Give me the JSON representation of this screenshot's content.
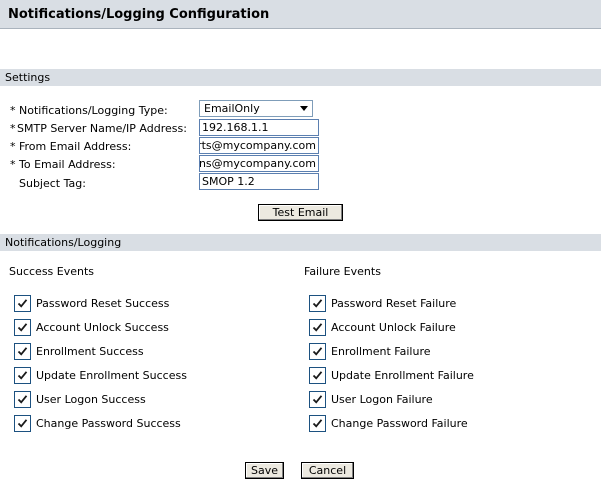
{
  "title": "Notifications/Logging Configuration",
  "settings": {
    "header": "Settings",
    "required_mark": "*",
    "fields": [
      {
        "label": "Notifications/Logging Type:",
        "required": true
      },
      {
        "label": "SMTP Server Name/IP Address:",
        "required": true,
        "value": "192.168.1.1"
      },
      {
        "label": "From Email Address:",
        "required": true,
        "value": "rts@mycompany.com"
      },
      {
        "label": "To Email Address:",
        "required": true,
        "value": "ins@mycompany.com"
      },
      {
        "label": "Subject Tag:",
        "required": false,
        "value": "SMOP 1.2"
      }
    ],
    "type_selected": "EmailOnly",
    "test_email_label": "Test Email"
  },
  "notifications": {
    "header": "Notifications/Logging",
    "success_header": "Success Events",
    "failure_header": "Failure Events",
    "success_events": [
      {
        "label": "Password Reset Success",
        "checked": true
      },
      {
        "label": "Account Unlock Success",
        "checked": true
      },
      {
        "label": "Enrollment Success",
        "checked": true
      },
      {
        "label": "Update Enrollment Success",
        "checked": true
      },
      {
        "label": "User Logon Success",
        "checked": true
      },
      {
        "label": "Change Password Success",
        "checked": true
      }
    ],
    "failure_events": [
      {
        "label": "Password Reset Failure",
        "checked": true
      },
      {
        "label": "Account Unlock Failure",
        "checked": true
      },
      {
        "label": "Enrollment Failure",
        "checked": true
      },
      {
        "label": "Update Enrollment Failure",
        "checked": true
      },
      {
        "label": "User Logon Failure",
        "checked": true
      },
      {
        "label": "Change Password Failure",
        "checked": true
      }
    ]
  },
  "footer": {
    "save_label": "Save",
    "cancel_label": "Cancel"
  },
  "colors": {
    "section_bg": "#d9dee4",
    "input_border": "#5b7fb0",
    "checkbox_border": "#1c5180"
  }
}
